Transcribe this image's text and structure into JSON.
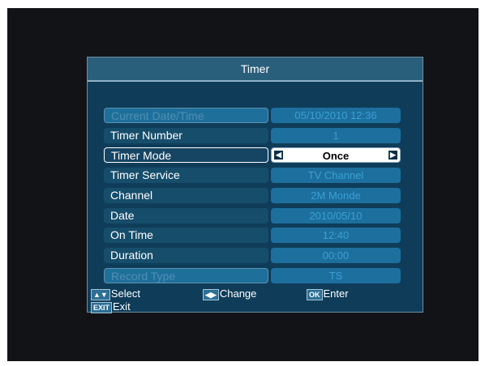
{
  "title": "Timer",
  "rows": [
    {
      "label": "Current Date/Time",
      "value": "05/10/2010 12:36"
    },
    {
      "label": "Timer Number",
      "value": "1"
    },
    {
      "label": "Timer Mode",
      "value": "Once"
    },
    {
      "label": "Timer Service",
      "value": "TV Channel"
    },
    {
      "label": "Channel",
      "value": "2M Monde"
    },
    {
      "label": "Date",
      "value": "2010/05/10"
    },
    {
      "label": "On Time",
      "value": "12:40"
    },
    {
      "label": "Duration",
      "value": "00:00"
    },
    {
      "label": "Record Type",
      "value": "TS"
    }
  ],
  "footer": {
    "select": {
      "key": "▲▼",
      "label": "Select"
    },
    "change": {
      "key": "◀▶",
      "label": "Change"
    },
    "enter": {
      "key": "OK",
      "label": "Enter"
    },
    "exit": {
      "key": "EXIT",
      "label": "Exit"
    }
  }
}
